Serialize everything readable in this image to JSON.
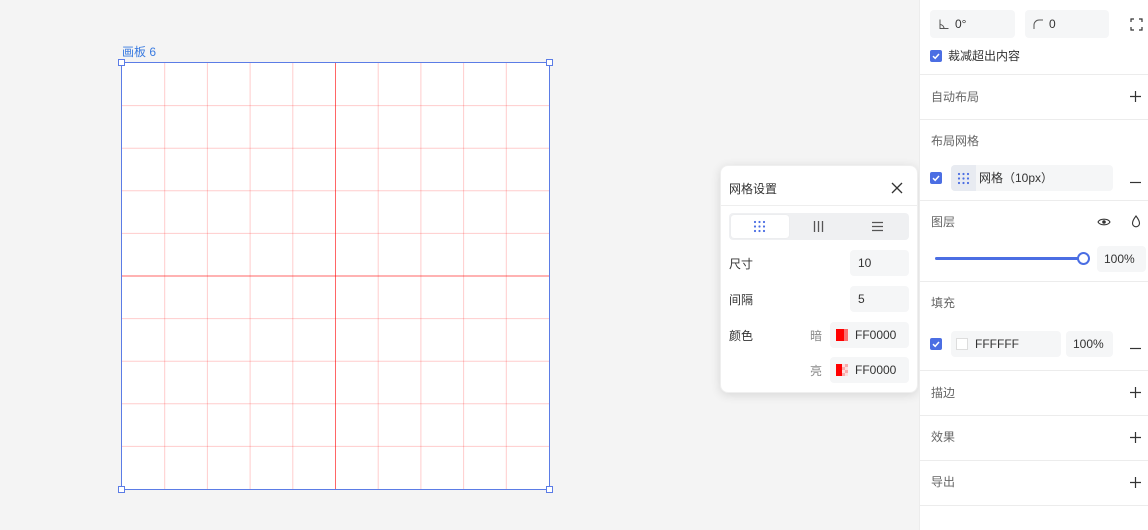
{
  "colors": {
    "accent": "#4b6ee3",
    "canvas_bg": "#f4f4f4",
    "artboard_label": "#3a7be0",
    "grid_line": "#ff0000"
  },
  "canvas": {
    "artboard": {
      "label": "画板 6"
    }
  },
  "properties_panel": {
    "rotation": {
      "icon": "angle-icon",
      "value": "0°"
    },
    "corner_radius": {
      "icon": "corner-radius-icon",
      "value": "0"
    },
    "independent_corners_icon": "fullscreen-icon",
    "clip_content": {
      "checked": true,
      "label": "裁减超出内容"
    },
    "sections": {
      "auto_layout": {
        "title": "自动布局",
        "action_icon": "plus-icon"
      },
      "layout_grid": {
        "title": "布局网格",
        "grid": {
          "checked": true,
          "icon": "grid-dots-icon",
          "label": "网格（10px）",
          "action_icon": "minus-icon"
        }
      },
      "layer": {
        "title": "图层",
        "icons": [
          "eye-icon",
          "droplet-icon"
        ],
        "opacity": 100,
        "opacity_label": "100%"
      },
      "fill": {
        "title": "填充",
        "item": {
          "checked": true,
          "color": "FFFFFF",
          "opacity": "100%",
          "action_icon": "minus-icon"
        }
      },
      "stroke": {
        "title": "描边",
        "action_icon": "plus-icon"
      },
      "effects": {
        "title": "效果",
        "action_icon": "plus-icon"
      },
      "export": {
        "title": "导出",
        "action_icon": "plus-icon"
      }
    }
  },
  "grid_settings_popup": {
    "title": "网格设置",
    "close_icon": "close-icon",
    "tabs": [
      {
        "icon": "grid-dots-icon",
        "selected": true
      },
      {
        "icon": "columns-icon",
        "selected": false
      },
      {
        "icon": "rows-icon",
        "selected": false
      }
    ],
    "size": {
      "label": "尺寸",
      "value": "10"
    },
    "gap": {
      "label": "间隔",
      "value": "5"
    },
    "color": {
      "label": "颜色",
      "dark": {
        "label": "暗",
        "value": "FF0000"
      },
      "light": {
        "label": "亮",
        "value": "FF0000"
      }
    }
  }
}
